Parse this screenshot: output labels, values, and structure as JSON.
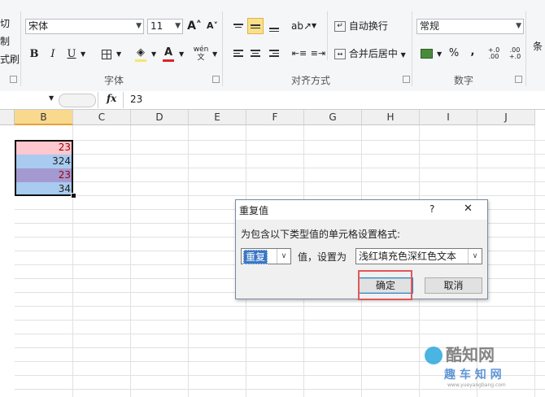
{
  "clipboard": {
    "cut_label": "切",
    "copy_label": "制",
    "format_painter_label": "式刷"
  },
  "font": {
    "name": "宋体",
    "size": "11",
    "grow_icon": "A˄",
    "shrink_icon": "A˅",
    "bold": "B",
    "italic": "I",
    "underline": "U",
    "color_label": "A",
    "phonetic_label": "wén",
    "group_label": "字体"
  },
  "alignment": {
    "wrap_text_label": "自动换行",
    "merge_center_label": "合并后居中",
    "group_label": "对齐方式"
  },
  "number": {
    "format": "常规",
    "percent": "%",
    "comma": ",",
    "increase_decimal": "+.0 .00",
    "decrease_decimal": ".00 +.0",
    "group_label": "数字"
  },
  "styles": {
    "conditional_label": "条"
  },
  "formula_bar": {
    "fx": "fx",
    "value": "23"
  },
  "columns": [
    "B",
    "C",
    "D",
    "E",
    "F",
    "G",
    "H",
    "I",
    "J"
  ],
  "cells": [
    {
      "value": "23",
      "fill": "#ffc7ce",
      "color": "#9c0006"
    },
    {
      "value": "324",
      "fill": "#a8cbef",
      "color": "#1f1f1f"
    },
    {
      "value": "23",
      "fill": "#a49ad1",
      "color": "#9c0006"
    },
    {
      "value": "34",
      "fill": "#a8cbef",
      "color": "#1f1f1f"
    }
  ],
  "dialog": {
    "title": "重复值",
    "help": "?",
    "close": "✕",
    "prompt": "为包含以下类型值的单元格设置格式:",
    "type_value": "重复",
    "middle_label": "值，设置为",
    "format_value": "浅红填充色深红色文本",
    "ok_label": "确定",
    "cancel_label": "取消"
  },
  "watermark": {
    "brand": "酷知网",
    "sub": "趣 车 知 网",
    "url": "www.yueyangbang.com"
  },
  "colors": {
    "accent_red": "#e15759",
    "fill_highlight": "#f7e66b",
    "font_red": "#d9252b"
  }
}
